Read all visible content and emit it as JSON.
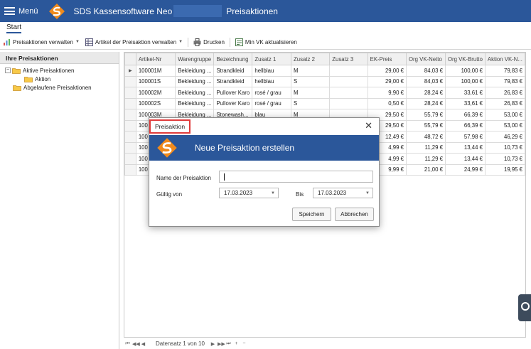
{
  "app": {
    "menu_label": "Menü",
    "title": "SDS Kassensoftware Neo",
    "subtitle": "Preisaktionen"
  },
  "tabs": [
    {
      "label": "Start"
    }
  ],
  "toolbar": {
    "manage_label": "Preisaktionen verwalten",
    "articles_label": "Artikel der Preisaktion verwalten",
    "print_label": "Drucken",
    "min_vk_label": "Min VK aktualisieren"
  },
  "left_panel": {
    "header": "Ihre Preisaktionen",
    "active_label": "Aktive Preisaktionen",
    "child_label": "Aktion",
    "expired_label": "Abgelaufene Preisaktionen"
  },
  "grid": {
    "columns": [
      "Artikel-Nr",
      "Warengruppe",
      "Bezeichnung",
      "Zusatz 1",
      "Zusatz 2",
      "Zusatz 3",
      "EK-Preis",
      "Org VK-Netto",
      "Org VK-Brutto",
      "Aktion VK-N..."
    ],
    "rows": [
      {
        "artnr": "100001M",
        "wg": "Bekleidung ...",
        "bez": "Strandkleid",
        "z1": "hellblau",
        "z2": "M",
        "z3": "",
        "ek": "29,00 €",
        "netto": "84,03 €",
        "brutto": "100,00 €",
        "aktion": "79,83 €"
      },
      {
        "artnr": "100001S",
        "wg": "Bekleidung ...",
        "bez": "Strandkleid",
        "z1": "hellblau",
        "z2": "S",
        "z3": "",
        "ek": "29,00 €",
        "netto": "84,03 €",
        "brutto": "100,00 €",
        "aktion": "79,83 €"
      },
      {
        "artnr": "100002M",
        "wg": "Bekleidung ...",
        "bez": "Pullover Karo",
        "z1": "rosé / grau",
        "z2": "M",
        "z3": "",
        "ek": "9,90 €",
        "netto": "28,24 €",
        "brutto": "33,61 €",
        "aktion": "26,83 €"
      },
      {
        "artnr": "100002S",
        "wg": "Bekleidung ...",
        "bez": "Pullover Karo",
        "z1": "rosé / grau",
        "z2": "S",
        "z3": "",
        "ek": "0,50 €",
        "netto": "28,24 €",
        "brutto": "33,61 €",
        "aktion": "26,83 €"
      },
      {
        "artnr": "100003M",
        "wg": "Bekleidung ...",
        "bez": "Stonewash...",
        "z1": "blau",
        "z2": "M",
        "z3": "",
        "ek": "29,50 €",
        "netto": "55,79 €",
        "brutto": "66,39 €",
        "aktion": "53,00 €"
      },
      {
        "artnr": "100",
        "wg": "",
        "bez": "",
        "z1": "",
        "z2": "",
        "z3": "",
        "ek": "29,50 €",
        "netto": "55,79 €",
        "brutto": "66,39 €",
        "aktion": "53,00 €"
      },
      {
        "artnr": "100",
        "wg": "",
        "bez": "",
        "z1": "",
        "z2": "",
        "z3": "",
        "ek": "12,49 €",
        "netto": "48,72 €",
        "brutto": "57,98 €",
        "aktion": "46,29 €"
      },
      {
        "artnr": "100",
        "wg": "",
        "bez": "",
        "z1": "",
        "z2": "",
        "z3": "",
        "ek": "4,99 €",
        "netto": "11,29 €",
        "brutto": "13,44 €",
        "aktion": "10,73 €"
      },
      {
        "artnr": "100",
        "wg": "",
        "bez": "",
        "z1": "",
        "z2": "",
        "z3": "",
        "ek": "4,99 €",
        "netto": "11,29 €",
        "brutto": "13,44 €",
        "aktion": "10,73 €"
      },
      {
        "artnr": "100",
        "wg": "",
        "bez": "",
        "z1": "",
        "z2": "",
        "z3": "",
        "ek": "9,99 €",
        "netto": "21,00 €",
        "brutto": "24,99 €",
        "aktion": "19,95 €"
      }
    ]
  },
  "pager": {
    "text": "Datensatz 1 von 10"
  },
  "dialog": {
    "window_title": "Preisaktion",
    "banner_title": "Neue Preisaktion erstellen",
    "name_label": "Name der Preisaktion",
    "name_value": "",
    "from_label": "Gültig von",
    "from_value": "17.03.2023",
    "to_label": "Bis",
    "to_value": "17.03.2023",
    "save_label": "Speichern",
    "cancel_label": "Abbrechen"
  },
  "colors": {
    "accent": "#2b579a",
    "highlight": "#e03b3b",
    "logo": "#f08a1c"
  },
  "icons": [
    "hamburger-icon",
    "sds-logo-icon",
    "chart-icon",
    "grid-icon",
    "printer-icon",
    "update-icon",
    "folder-icon",
    "close-icon",
    "chevron-down-icon"
  ]
}
